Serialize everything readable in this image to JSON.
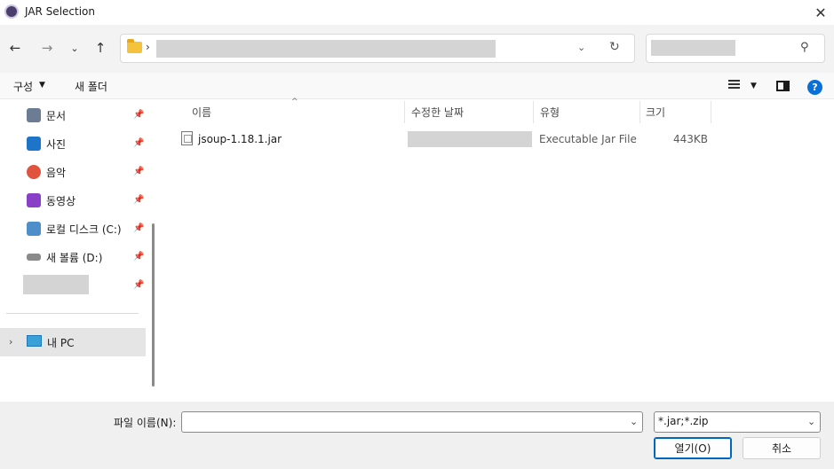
{
  "window": {
    "title": "JAR Selection",
    "close_glyph": "✕"
  },
  "nav": {
    "back_glyph": "←",
    "forward_glyph": "→",
    "recent_glyph": "⌄",
    "up_glyph": "↑",
    "crumb_separator": "›",
    "dropdown_glyph": "⌄",
    "refresh_glyph": "↻",
    "search_glyph": "⚲"
  },
  "toolbar": {
    "organize_label": "구성",
    "organize_caret": "▼",
    "new_folder_label": "새 폴더",
    "view_caret": "▼",
    "help_glyph": "?"
  },
  "sidebar": {
    "items": [
      {
        "label": "문서",
        "icon": "document-icon",
        "color": "#6b7c93"
      },
      {
        "label": "사진",
        "icon": "pictures-icon",
        "color": "#1e74c8"
      },
      {
        "label": "음악",
        "icon": "music-icon",
        "color": "#e0533d"
      },
      {
        "label": "동영상",
        "icon": "video-icon",
        "color": "#8a3fc7"
      },
      {
        "label": "로컬 디스크 (C:)",
        "icon": "local-disk-icon",
        "color": "#4f8fc9"
      },
      {
        "label": "새 볼륨 (D:)",
        "icon": "drive-icon",
        "color": "#8a8a8a"
      }
    ],
    "pin_glyph": "📌",
    "this_pc": {
      "label": "내 PC",
      "chevron": "›"
    }
  },
  "columns": {
    "name": "이름",
    "modified": "수정한 날짜",
    "type": "유형",
    "size": "크기",
    "sort_glyph": "^"
  },
  "files": [
    {
      "name": "jsoup-1.18.1.jar",
      "type": "Executable Jar File",
      "size": "443KB"
    }
  ],
  "footer": {
    "filename_label": "파일 이름(N):",
    "filename_value": "",
    "filename_caret": "⌄",
    "filter_value": "*.jar;*.zip",
    "filter_caret": "⌄",
    "open_label": "열기(O)",
    "cancel_label": "취소"
  },
  "colors": {
    "accent": "#0067c0",
    "help_blue": "#0a6fd6",
    "folder_yellow": "#f5c33b",
    "redacted_gray": "#d4d4d4"
  }
}
